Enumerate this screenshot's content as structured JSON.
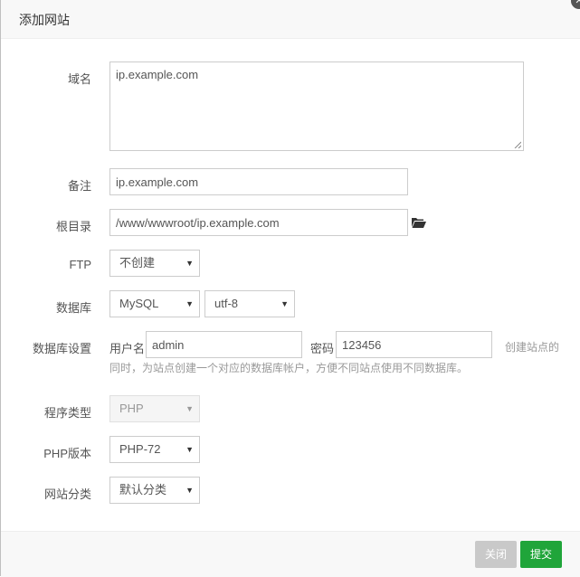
{
  "dialog": {
    "title": "添加网站"
  },
  "form": {
    "domain": {
      "label": "域名",
      "value": "ip.example.com"
    },
    "remark": {
      "label": "备注",
      "value": "ip.example.com"
    },
    "root_dir": {
      "label": "根目录",
      "value": "/www/wwwroot/ip.example.com",
      "icon": "folder-open-icon"
    },
    "ftp": {
      "label": "FTP",
      "selected": "不创建"
    },
    "database": {
      "label": "数据库",
      "type_selected": "MySQL",
      "charset_selected": "utf-8"
    },
    "db_settings": {
      "label": "数据库设置",
      "username_label": "用户名",
      "username_value": "admin",
      "password_label": "密码",
      "password_value": "123456",
      "hint_part1": "创建站点的",
      "hint_part2": "同时，为站点创建一个对应的数据库帐户，方便不同站点使用不同数据库。"
    },
    "program_type": {
      "label": "程序类型",
      "selected": "PHP"
    },
    "php_version": {
      "label": "PHP版本",
      "selected": "PHP-72"
    },
    "site_category": {
      "label": "网站分类",
      "selected": "默认分类"
    }
  },
  "footer": {
    "close_label": "关闭",
    "submit_label": "提交",
    "close_color": "#c9c9c9",
    "submit_color": "#20a53a"
  }
}
